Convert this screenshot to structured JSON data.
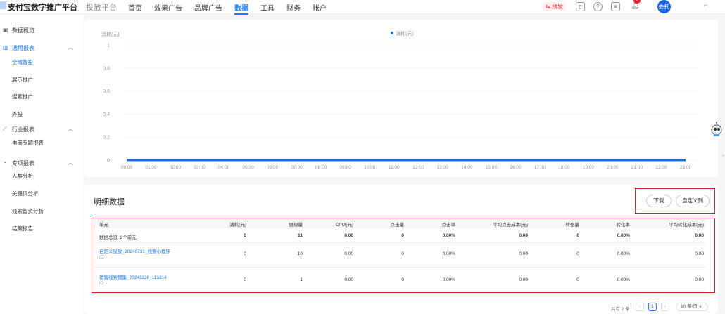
{
  "header": {
    "brand": "支付宝数字推广平台",
    "brand_sub": "投放平台",
    "nav": [
      {
        "label": "首页"
      },
      {
        "label": "效果广告"
      },
      {
        "label": "品牌广告"
      },
      {
        "label": "数据",
        "active": true
      },
      {
        "label": "工具"
      },
      {
        "label": "财务"
      },
      {
        "label": "账户"
      }
    ],
    "pre_badge": "⇆ 预发",
    "avatar_text": "委托"
  },
  "sidebar": {
    "groups": [
      {
        "label": "数据概览",
        "icon": "dashboard-icon",
        "caret": ""
      },
      {
        "label": "通用报表",
        "icon": "bar-chart-icon",
        "caret": "^",
        "active": true,
        "items": [
          "全域智投",
          "展示推广",
          "搜索推广",
          "外投"
        ]
      },
      {
        "label": "行业报表",
        "icon": "line-chart-icon",
        "caret": "^",
        "items": [
          "电商专题报表"
        ]
      },
      {
        "label": "专项报表",
        "icon": "special-report-icon",
        "caret": "^",
        "items": [
          "人群分析",
          "关键词分析",
          "线索留资分析",
          "结案报告"
        ]
      }
    ]
  },
  "chart_data": {
    "type": "line",
    "ylabel": "消耗(元)",
    "legend": "消耗(元)",
    "legend_position": "top-center",
    "ylim": [
      0,
      1
    ],
    "yticks": [
      "0",
      "0.2",
      "0.4",
      "0.6",
      "0.8",
      "1"
    ],
    "x": [
      "00:00",
      "01:00",
      "02:00",
      "03:00",
      "04:00",
      "05:00",
      "06:00",
      "07:00",
      "08:00",
      "09:00",
      "10:00",
      "11:00",
      "12:00",
      "13:00",
      "14:00",
      "15:00",
      "16:00",
      "17:00",
      "18:00",
      "19:00",
      "20:00",
      "21:00",
      "22:00",
      "23:00"
    ],
    "series": [
      {
        "name": "消耗(元)",
        "values": [
          0,
          0,
          0,
          0,
          0,
          0,
          0,
          0,
          0,
          0,
          0,
          0,
          0,
          0,
          0,
          0,
          0,
          0,
          0,
          0,
          0,
          0,
          0,
          0
        ]
      }
    ],
    "grid": true,
    "color": "#1a6fe8"
  },
  "detail": {
    "title": "明细数据",
    "download_label": "下载",
    "custom_columns_label": "自定义列",
    "columns": [
      "单元",
      "消耗(元)",
      "展现量",
      "CPM(元)",
      "点击量",
      "点击率",
      "平均点击成本(元)",
      "转化量",
      "转化率",
      "平均转化成本(元)"
    ],
    "summary": {
      "label": "数据总览: 2个单元",
      "values": [
        "0",
        "11",
        "0.00",
        "0",
        "0.00%",
        "0.00",
        "0",
        "0.00%",
        "0.00"
      ]
    },
    "rows": [
      {
        "name": "自定义投放_20240731_线索小程序",
        "id": "ID: -",
        "values": [
          "0",
          "10",
          "0.00",
          "0",
          "0.00%",
          "0.00",
          "0",
          "0.00%",
          "0.00"
        ]
      },
      {
        "name": "销售线索搜集_20241128_113314",
        "id": "ID: -",
        "values": [
          "0",
          "1",
          "0.00",
          "0",
          "0.00%",
          "0.00",
          "0",
          "0.00%",
          "0.00"
        ]
      }
    ]
  },
  "pagination": {
    "total": "共有 2 条",
    "current": "1",
    "page_size": "10 条/页 ∨"
  }
}
